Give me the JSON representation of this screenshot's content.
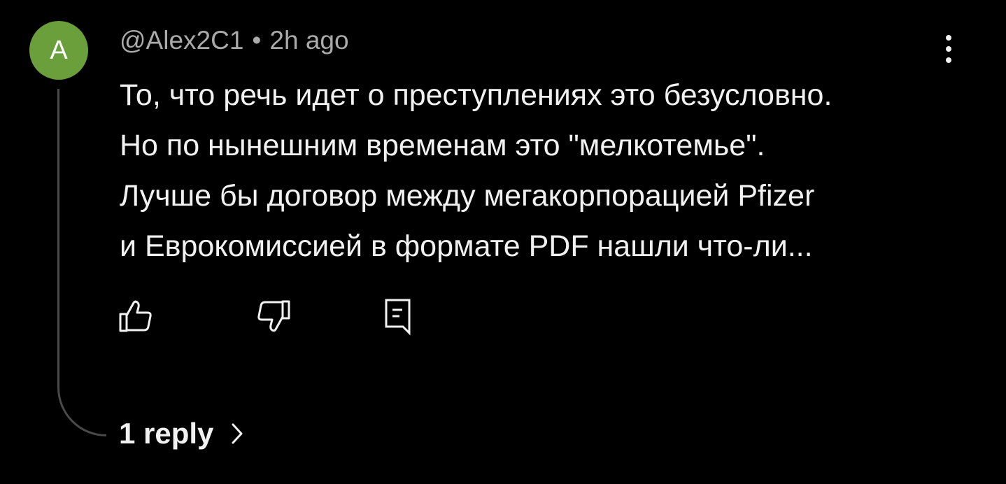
{
  "comment": {
    "avatar_letter": "A",
    "avatar_color": "#6a9f3c",
    "author": "@Alex2C1",
    "separator": "•",
    "time": "2h ago",
    "lines": [
      "То, что речь идет о преступлениях это безусловно.",
      "Но по нынешним временам это \"мелкотемье\".",
      "Лучше бы договор между мегакорпорацией Pfizer",
      "и Еврокомиссией в формате PDF нашли что-ли..."
    ]
  },
  "actions": {
    "like_icon": "thumb-up-icon",
    "dislike_icon": "thumb-down-icon",
    "reply_icon": "comment-reply-icon",
    "menu_icon": "more-vertical-icon"
  },
  "replies": {
    "label": "1 reply",
    "icon": "chevron-right-icon"
  }
}
